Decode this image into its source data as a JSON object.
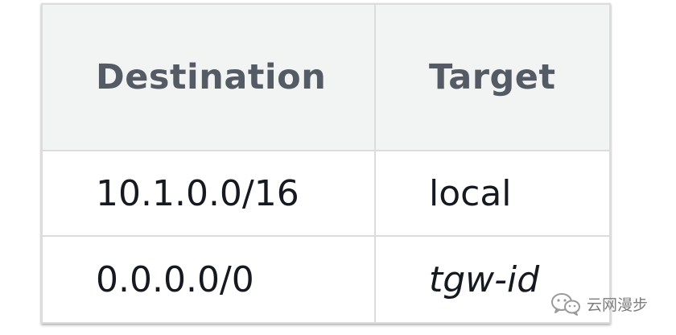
{
  "table": {
    "headers": [
      "Destination",
      "Target"
    ],
    "rows": [
      {
        "destination": "10.1.0.0/16",
        "target": "local",
        "target_italic": false
      },
      {
        "destination": "0.0.0.0/0",
        "target": "tgw-id",
        "target_italic": true
      }
    ]
  },
  "watermark": {
    "text": "云网漫步",
    "icon": "wechat-icon"
  },
  "colors": {
    "header_bg": "#f2f3f3",
    "header_text": "#545b64",
    "cell_text": "#16191f",
    "border": "#dcdcdc"
  }
}
